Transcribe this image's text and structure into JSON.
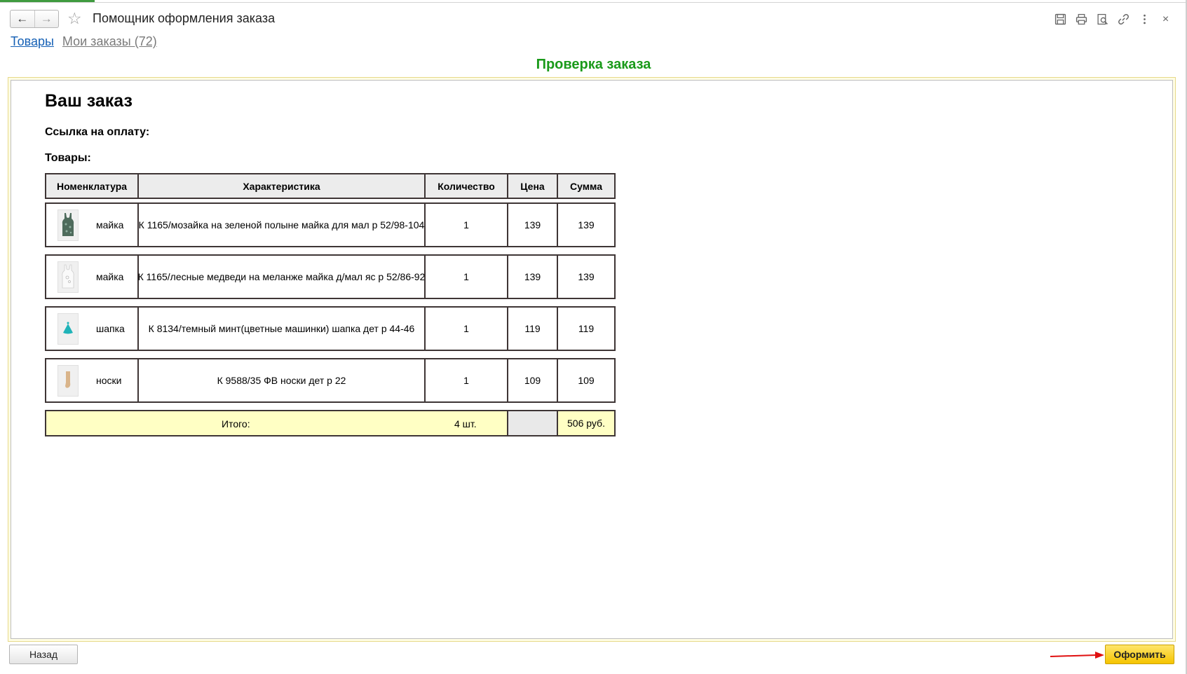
{
  "window": {
    "title": "Помощник оформления заказа",
    "back_label": "←",
    "forward_label": "→",
    "star_label": "☆",
    "close_label": "×",
    "tools": [
      "save-icon",
      "print-icon",
      "preview-icon",
      "link-icon",
      "more-icon",
      "close-icon"
    ]
  },
  "nav_links": {
    "goods": "Товары",
    "orders": "Мои заказы (72)"
  },
  "page": {
    "header": "Проверка заказа",
    "order_title": "Ваш заказ",
    "payment_link_label": "Ссылка на оплату:",
    "goods_label": "Товары:"
  },
  "table": {
    "columns": [
      "Номенклатура",
      "Характеристика",
      "Количество",
      "Цена",
      "Сумма"
    ],
    "rows": [
      {
        "name": "майка",
        "characteristic": "К 1165/мозайка на зеленой полыне майка для мал р 52/98-104",
        "qty": "1",
        "price": "139",
        "sum": "139",
        "thumb": "green-tank-top-image"
      },
      {
        "name": "майка",
        "characteristic": "К 1165/лесные медведи на меланже майка д/мал яс р 52/86-92",
        "qty": "1",
        "price": "139",
        "sum": "139",
        "thumb": "white-tank-top-image"
      },
      {
        "name": "шапка",
        "characteristic": "К 8134/темный минт(цветные машинки) шапка дет р 44-46",
        "qty": "1",
        "price": "119",
        "sum": "119",
        "thumb": "mint-hat-image"
      },
      {
        "name": "носки",
        "characteristic": "К 9588/35 ФВ носки дет р 22",
        "qty": "1",
        "price": "109",
        "sum": "109",
        "thumb": "beige-socks-image"
      }
    ],
    "total": {
      "label": "Итого:",
      "qty": "4 шт.",
      "price": "",
      "sum": "506 руб."
    }
  },
  "buttons": {
    "back": "Назад",
    "submit": "Оформить"
  },
  "colors": {
    "header_green": "#1a9a1a",
    "submit_yellow": "#f5c400",
    "total_row": "#ffffc4",
    "arrow_red": "#e01010",
    "link_blue": "#1560b5"
  }
}
